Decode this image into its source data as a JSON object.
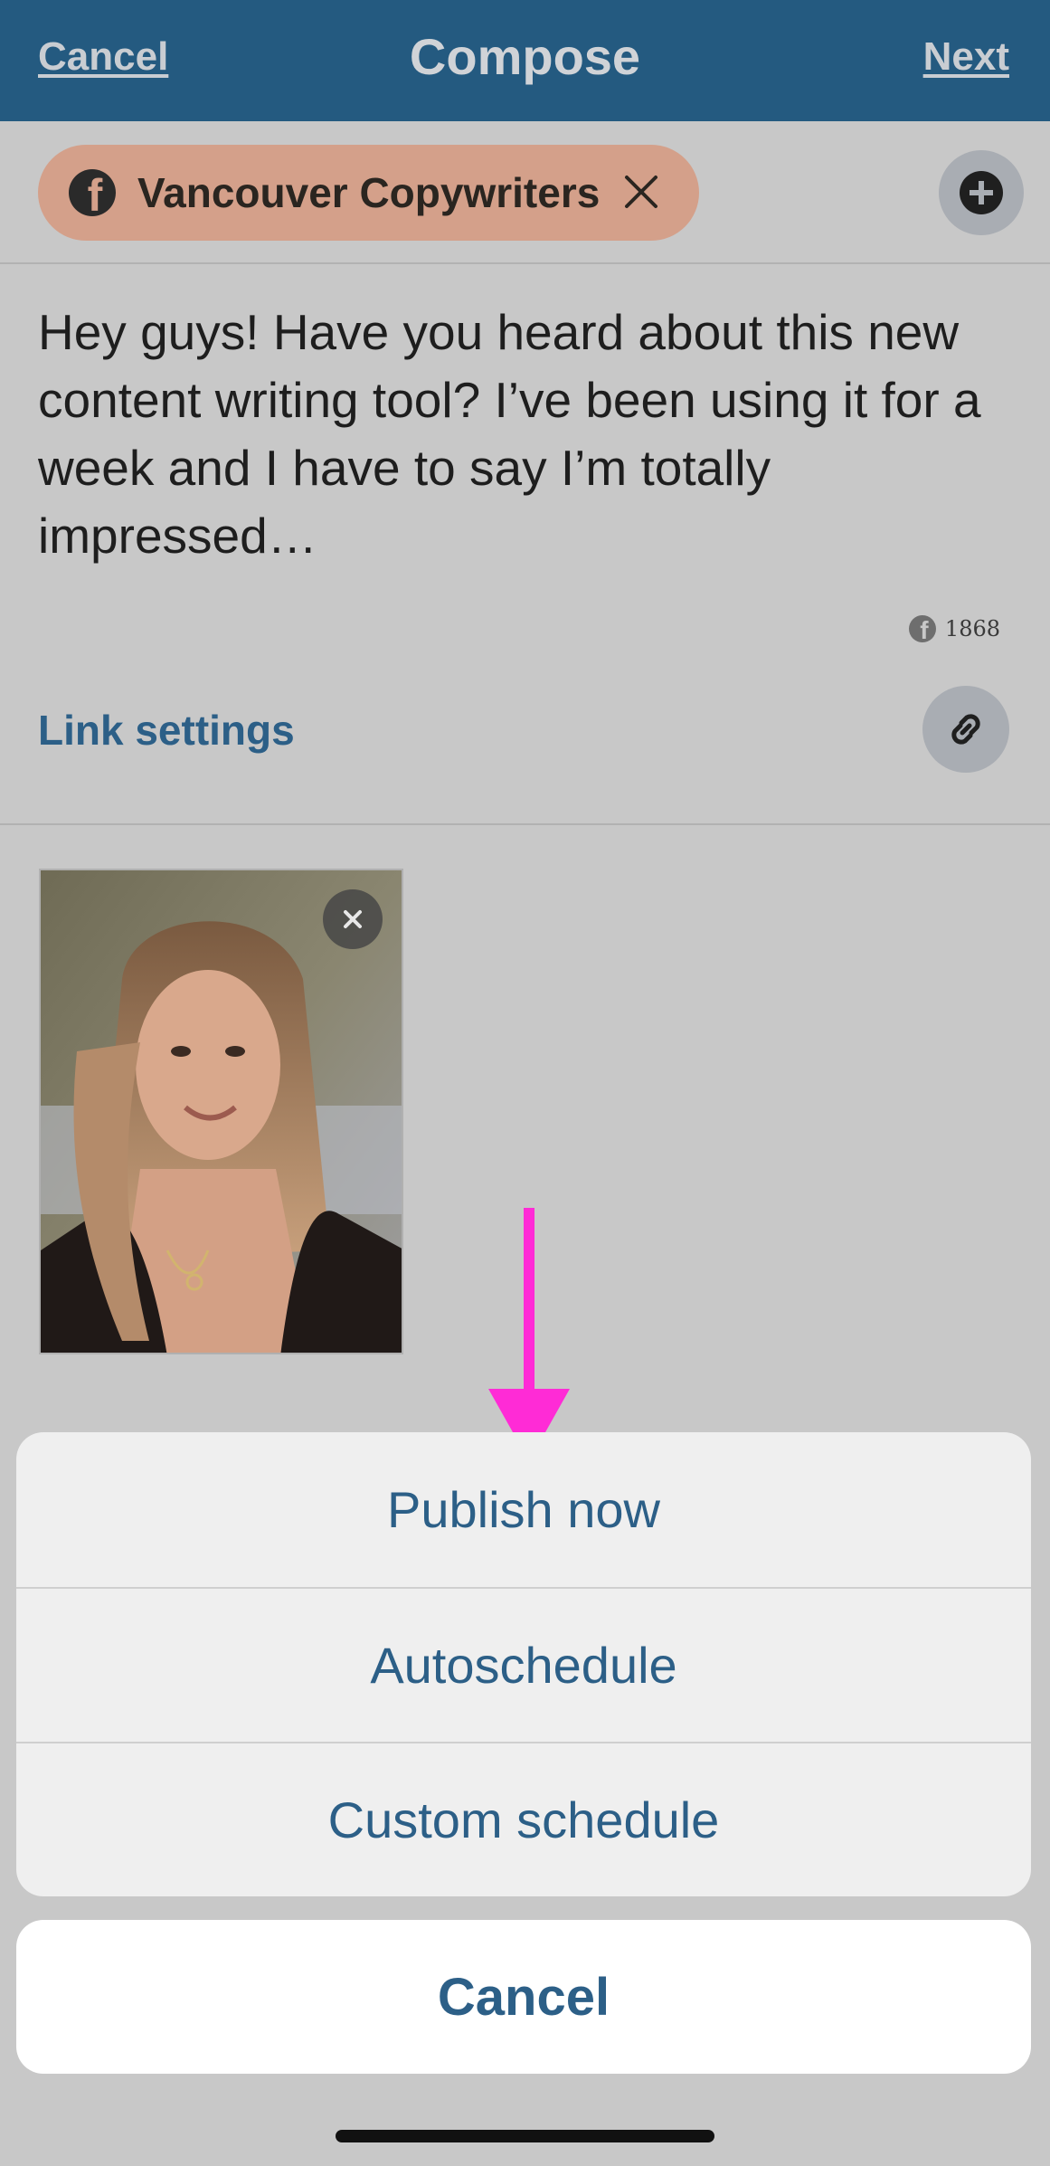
{
  "header": {
    "cancel_label": "Cancel",
    "title": "Compose",
    "next_label": "Next"
  },
  "account_chip": {
    "network_icon": "facebook-icon",
    "label": "Vancouver Copywriters",
    "chip_color": "#d4a08a"
  },
  "post": {
    "text": "Hey guys! Have you heard about this new content writing tool? I’ve been using it for a week and I have to say I’m totally impressed…",
    "character_count": "1868"
  },
  "link_settings": {
    "label": "Link settings",
    "icon": "link-icon"
  },
  "attachment": {
    "type": "photo",
    "remove_icon": "close-icon"
  },
  "action_sheet": {
    "items": [
      {
        "label": "Publish now"
      },
      {
        "label": "Autoschedule"
      },
      {
        "label": "Custom schedule"
      }
    ],
    "cancel_label": "Cancel"
  },
  "colors": {
    "header_bg": "#245a80",
    "accent_text": "#2c5f87",
    "annotation_arrow": "#ff2bd6"
  }
}
